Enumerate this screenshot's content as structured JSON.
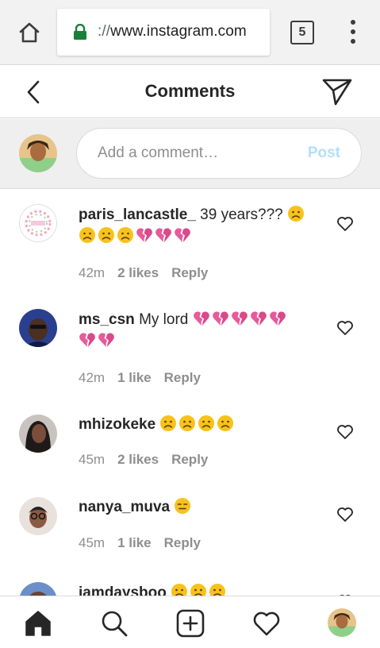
{
  "browser": {
    "url_scheme": "://",
    "url_host": "www.instagram.com",
    "tab_count": "5"
  },
  "header": {
    "title": "Comments"
  },
  "composer": {
    "placeholder": "Add a comment…",
    "post_label": "Post"
  },
  "comments": [
    {
      "username": "paris_lancastle_",
      "text": "39 years???",
      "emoji_line1": [
        "frown"
      ],
      "emoji_line2": [
        "frown",
        "frown",
        "frown",
        "broken-heart",
        "broken-heart",
        "broken-heart"
      ],
      "time": "42m",
      "likes": "2 likes",
      "reply": "Reply"
    },
    {
      "username": "ms_csn",
      "text": "My lord",
      "emoji_line1": [
        "broken-heart",
        "broken-heart",
        "broken-heart",
        "broken-heart",
        "broken-heart"
      ],
      "emoji_line2": [
        "broken-heart",
        "broken-heart"
      ],
      "time": "42m",
      "likes": "1 like",
      "reply": "Reply"
    },
    {
      "username": "mhizokeke",
      "text": "",
      "emoji_line1": [
        "frown",
        "frown",
        "frown",
        "frown"
      ],
      "emoji_line2": [],
      "time": "45m",
      "likes": "2 likes",
      "reply": "Reply"
    },
    {
      "username": "nanya_muva",
      "text": "",
      "emoji_line1": [
        "expressionless"
      ],
      "emoji_line2": [],
      "time": "45m",
      "likes": "1 like",
      "reply": "Reply"
    },
    {
      "username": "iamdaysboo",
      "text": "",
      "emoji_line1": [
        "frown",
        "frown",
        "frown"
      ],
      "emoji_line2": [],
      "time": "",
      "likes": "",
      "reply": ""
    }
  ],
  "colors": {
    "text": "#262626",
    "muted": "#8e8e8e",
    "post_disabled": "#b2dffc",
    "secure_lock": "#188038",
    "emoji_yellow": "#f7c21b",
    "broken_heart": "#e75a9b"
  },
  "icons": {
    "browser_home": "home-outline-icon",
    "lock": "lock-icon",
    "tabs": "tab-switcher-icon",
    "menu": "kebab-menu-icon",
    "back": "chevron-left-icon",
    "direct": "paper-plane-icon",
    "like": "heart-outline-icon",
    "nav_home": "home-filled-icon",
    "nav_search": "search-icon",
    "nav_add": "add-square-icon",
    "nav_activity": "heart-outline-icon"
  }
}
